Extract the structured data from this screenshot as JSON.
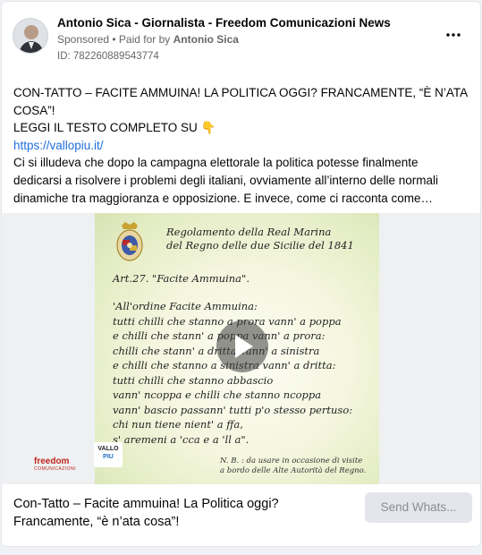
{
  "post": {
    "page_name": "Antonio Sica - Giornalista - Freedom Comunicazioni News",
    "sponsored_label": "Sponsored",
    "separator": " • ",
    "paid_for_prefix": "Paid for by ",
    "paid_for_name": "Antonio Sica",
    "ad_id": "ID: 782260889543774",
    "more_icon": "more-horizontal-icon",
    "body": {
      "line1": "CON-TATTO – FACITE AMMUINA! LA POLITICA OGGI? FRANCAMENTE, “È N’ATA",
      "line2": "COSA”!",
      "line3": "LEGGI IL TESTO COMPLETO SU 👇",
      "link": "https://vallopiu.it/",
      "line5": "Ci si illudeva che dopo la campagna elettorale la politica potesse finalmente",
      "line6": "dedicarsi a risolvere i problemi degli italiani, ovviamente all’interno delle normali",
      "line7": "dinamiche tra maggioranza e opposizione. E invece, come ci racconta come…"
    }
  },
  "media": {
    "title_line1": "Regolamento della Real Marina",
    "title_line2": "del Regno delle due Sicilie del 1841",
    "article": "Art.27. \"Facite Ammuina\".",
    "poem": [
      "'All'ordine Facite Ammuina:",
      "tutti chilli che stanno a prora vann' a poppa",
      "e chilli che stann' a poppa vann' a prora:",
      "chilli che stann' a dritta vann' a sinistra",
      "e chilli che stanno a sinistra vann' a dritta:",
      "tutti chilli che stanno abbascio",
      "vann' ncoppa e chilli che stanno ncoppa",
      "vann' bascio passann' tutti p'o stesso pertuso:",
      "chi nun tiene nient' a ffa,",
      "s' aremeni a 'cca e a 'll a\"."
    ],
    "note_line1": "N. B. : da usare in occasione di visite",
    "note_line2": "a bordo delle Alte Autorità del Regno.",
    "logo_freedom": "freedom",
    "logo_freedom_sub": "COMUNICAZIONI",
    "logo_vallo_line1": "VALLO",
    "logo_vallo_line2": "PIU",
    "play_icon": "play-icon",
    "colors": {
      "freedom_red": "#c0261d",
      "vallo_blue": "#1e6ec7",
      "link_blue": "#216fdb"
    }
  },
  "footer": {
    "headline_line1": "Con-Tatto – Facite ammuina! La Politica oggi?",
    "headline_line2": "Francamente, “è n’ata cosa”!",
    "cta_label": "Send Whats..."
  }
}
